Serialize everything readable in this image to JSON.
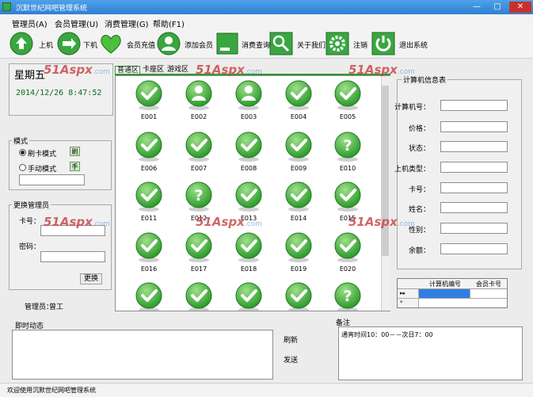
{
  "window": {
    "title": "沉默世纪网吧管理系统",
    "min": "—",
    "max": "□",
    "close": "✕"
  },
  "menu": [
    "管理员(A)",
    "会员管理(U)",
    "消费管理(G)",
    "帮助(F1)"
  ],
  "toolbar": [
    {
      "label": "上机",
      "icon": "arrow-up-icon"
    },
    {
      "label": "下机",
      "icon": "arrow-down-icon"
    },
    {
      "label": "会员充值",
      "icon": "heart-icon"
    },
    {
      "label": "添加会员",
      "icon": "user-icon"
    },
    {
      "label": "消费查询",
      "icon": "search-icon"
    },
    {
      "label": "关于我们",
      "icon": "magnifier-icon"
    },
    {
      "label": "注销",
      "icon": "gear-icon"
    },
    {
      "label": "退出系统",
      "icon": "power-icon"
    }
  ],
  "date_panel": {
    "weekday": "星期五",
    "datetime": "2014/12/26  8:47:52"
  },
  "tabs": [
    "普通区",
    "卡座区",
    "游戏区"
  ],
  "machines": [
    {
      "id": "E001",
      "status": "check"
    },
    {
      "id": "E002",
      "status": "user"
    },
    {
      "id": "E003",
      "status": "user"
    },
    {
      "id": "E004",
      "status": "check"
    },
    {
      "id": "E005",
      "status": "check"
    },
    {
      "id": "E006",
      "status": "check"
    },
    {
      "id": "E007",
      "status": "check"
    },
    {
      "id": "E008",
      "status": "check"
    },
    {
      "id": "E009",
      "status": "check"
    },
    {
      "id": "E010",
      "status": "question"
    },
    {
      "id": "E011",
      "status": "check"
    },
    {
      "id": "E012",
      "status": "question"
    },
    {
      "id": "E013",
      "status": "check"
    },
    {
      "id": "E014",
      "status": "check"
    },
    {
      "id": "E015",
      "status": "check"
    },
    {
      "id": "E016",
      "status": "check"
    },
    {
      "id": "E017",
      "status": "check"
    },
    {
      "id": "E018",
      "status": "check"
    },
    {
      "id": "E019",
      "status": "check"
    },
    {
      "id": "E020",
      "status": "check"
    },
    {
      "id": "",
      "status": "check"
    },
    {
      "id": "",
      "status": "check"
    },
    {
      "id": "",
      "status": "check"
    },
    {
      "id": "",
      "status": "check"
    },
    {
      "id": "",
      "status": "question"
    }
  ],
  "info": {
    "title": "计算机信息表",
    "labels": [
      "计算机号：",
      "价格：",
      "状态：",
      "上机类型：",
      "卡号：",
      "姓名：",
      "性别：",
      "余额："
    ]
  },
  "machine_table": {
    "headers": [
      "计算机编号",
      "会员卡号"
    ],
    "row_marker": "▸▸",
    "row2_marker": "*"
  },
  "mode": {
    "title": "模式",
    "swipe": "刷卡模式",
    "manual": "手动模式",
    "swipe_icon": "刷",
    "manual_icon": "手",
    "input": ""
  },
  "admin": {
    "title": "更换管理员",
    "card_label": "卡号：",
    "pwd_label": "密码：",
    "card": "",
    "pwd": "",
    "change_btn": "更换"
  },
  "current_admin": {
    "label": "管理员：",
    "name": "曾工"
  },
  "live": {
    "title": "即时动态",
    "refresh": "刷新",
    "send": "发送"
  },
  "note": {
    "title": "备注",
    "text": "通宵时间10：00－－次日7：00"
  },
  "status": {
    "text": "欢迎使用沉默世纪网吧管理系统"
  },
  "watermark": {
    "main": "51Aspx",
    "suffix": ".com"
  },
  "colors": {
    "titlebar": "#3a8ee0",
    "accent_green": "#3aa640",
    "tab_active": "#2e9a2e"
  }
}
